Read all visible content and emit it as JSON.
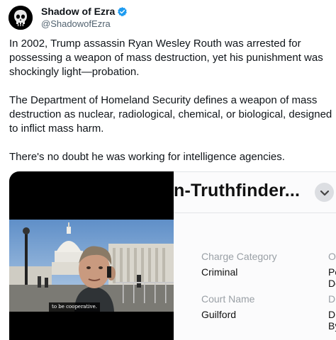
{
  "author": {
    "name": "Shadow of Ezra",
    "handle": "@ShadowofEzra",
    "verified_icon": "verified-badge-icon",
    "avatar_icon": "skull-avatar-icon"
  },
  "tweet": {
    "paragraphs": [
      "In 2002, Trump assassin Ryan Wesley Routh was arrested for possessing a weapon of mass destruction, yet his punishment was shockingly light—probation.",
      "The Department of Homeland Security defines a weapon of mass destruction as nuclear, radiological, chemical, or biological, designed to inflict mass harm.",
      "There's no doubt he was working for intelligence agencies."
    ]
  },
  "media": {
    "video_caption": "to be cooperative.",
    "record_title": "n-Truthfinder...",
    "fields": [
      {
        "label": "Charge Category",
        "value": "Criminal"
      },
      {
        "label": "Court Name",
        "value": "Guilford"
      }
    ],
    "cut_labels": [
      "O",
      "Di"
    ],
    "cut_values": [
      "Po",
      "De",
      "Di",
      "By"
    ],
    "colors": {
      "accent": "#1d9bf0",
      "label_grey": "#9aa0a6"
    }
  }
}
